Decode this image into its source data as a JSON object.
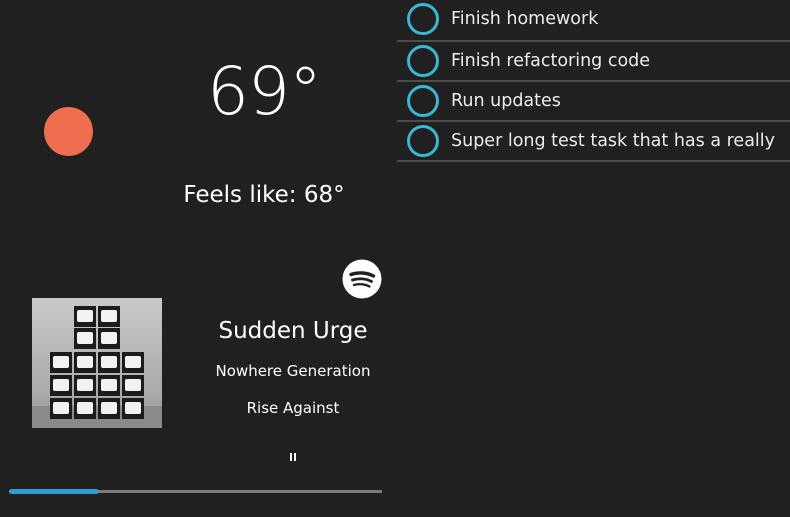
{
  "weather": {
    "temperature": "69°",
    "feels_like": "Feels like: 68°",
    "icon": "sun-icon",
    "icon_color": "#ee6e4f"
  },
  "tasks": {
    "accent_color": "#3ab7d2",
    "items": [
      {
        "label": "Finish homework"
      },
      {
        "label": "Finish refactoring code"
      },
      {
        "label": "Run updates"
      },
      {
        "label": "Super long test task that has a really lon..."
      }
    ]
  },
  "now_playing": {
    "service_icon": "spotify-icon",
    "title": "Sudden Urge",
    "album": "Nowhere Generation",
    "artist": "Rise Against",
    "pause_icon": "pause-icon",
    "progress": 0.24,
    "progress_color": "#2e9cd2"
  }
}
